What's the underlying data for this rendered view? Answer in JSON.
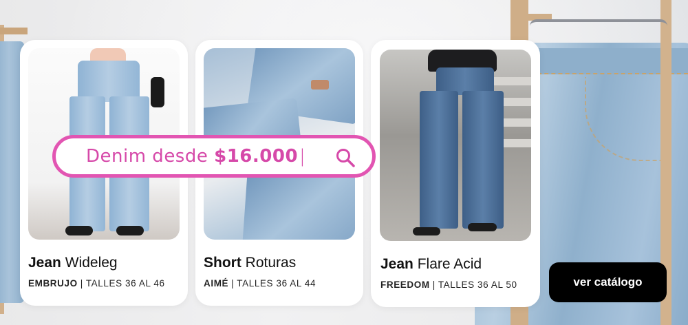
{
  "search": {
    "prefix": "Denim desde ",
    "price": "$16.000",
    "cursor": "|"
  },
  "cards": [
    {
      "type": "Jean",
      "name": "Wideleg",
      "brand": "EMBRUJO",
      "sizes": "TALLES 36 AL 46"
    },
    {
      "type": "Short",
      "name": "Roturas",
      "brand": "AIMÉ",
      "sizes": "TALLES 36 AL 44"
    },
    {
      "type": "Jean",
      "name": "Flare Acid",
      "brand": "FREEDOM",
      "sizes": "TALLES 36 AL 50"
    }
  ],
  "cta": {
    "label": "ver catálogo"
  },
  "separator": "|",
  "colors": {
    "accent": "#e255b2",
    "text_accent": "#d649a9",
    "cta_bg": "#000000",
    "card_bg": "#ffffff"
  },
  "icons": {
    "search": "magnifier-icon"
  }
}
